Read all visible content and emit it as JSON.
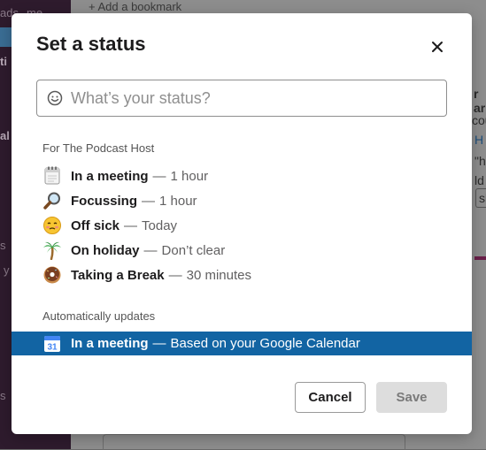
{
  "background": {
    "bookmark_text": "+  Add a bookmark",
    "sidebar_snippets": [
      "ads",
      "me",
      "ti",
      "al",
      "s",
      "y",
      "s"
    ],
    "right_snippets": [
      "r ar",
      "cou",
      "H",
      "\"h",
      "ld",
      "sk"
    ]
  },
  "modal": {
    "title": "Set a status",
    "close_icon": "close-icon",
    "status_input": {
      "placeholder": "What’s your status?",
      "value": "",
      "icon": "smiley-icon"
    },
    "preset_section_label": "For The Podcast Host",
    "presets": [
      {
        "icon": "calendar-icon",
        "label": "In a meeting",
        "separator": "—",
        "duration": "1 hour"
      },
      {
        "icon": "magnifier-icon",
        "label": "Focussing",
        "separator": "—",
        "duration": "1 hour"
      },
      {
        "icon": "sick-face-icon",
        "label": "Off sick",
        "separator": "—",
        "duration": "Today"
      },
      {
        "icon": "palm-tree-icon",
        "label": "On holiday",
        "separator": "—",
        "duration": "Don’t clear"
      },
      {
        "icon": "donut-icon",
        "label": "Taking a Break",
        "separator": "—",
        "duration": "30 minutes"
      }
    ],
    "auto_section_label": "Automatically updates",
    "auto_item": {
      "icon": "google-calendar-icon",
      "icon_text": "31",
      "label": "In a meeting",
      "separator": "—",
      "description": "Based on your Google Calendar",
      "highlight_color": "#1264a3"
    },
    "cancel_label": "Cancel",
    "save_label": "Save"
  }
}
